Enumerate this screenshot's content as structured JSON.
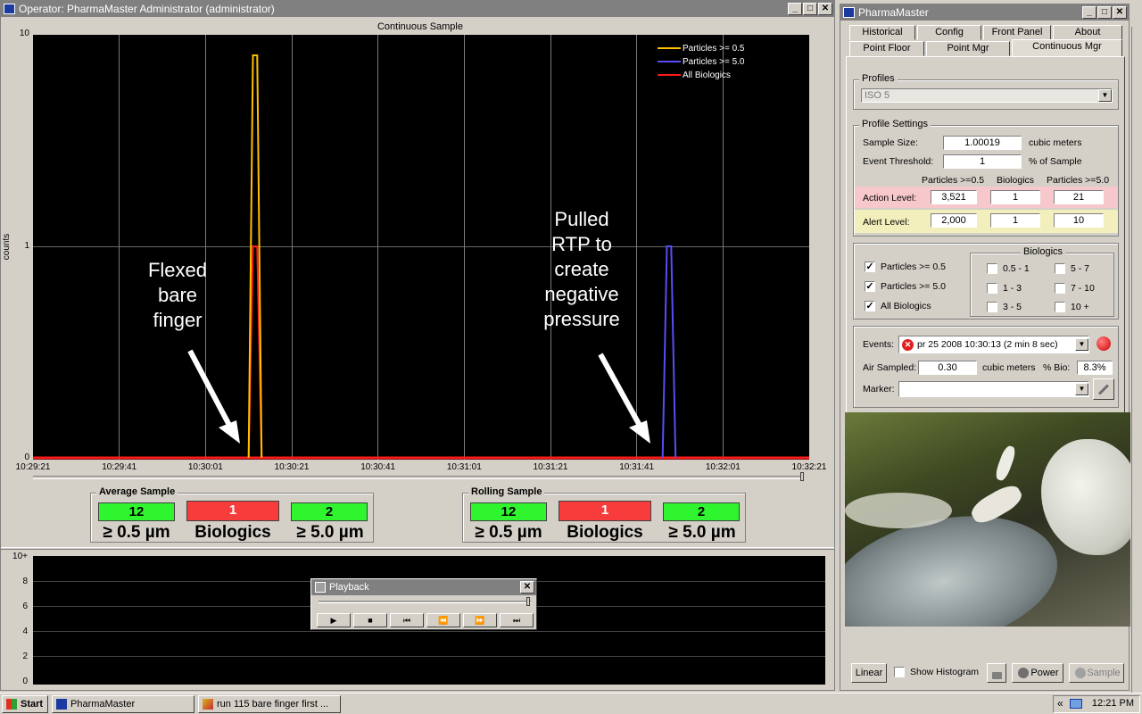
{
  "operator_window": {
    "title": "Operator: PharmaMaster Administrator (administrator)",
    "controls": [
      "_",
      "□",
      "✕"
    ]
  },
  "main_chart": {
    "title": "Continuous Sample",
    "ylabel": "counts",
    "yticks": [
      "10",
      "1",
      "0"
    ],
    "xticks": [
      "10:29:21",
      "10:29:41",
      "10:30:01",
      "10:30:21",
      "10:30:41",
      "10:31:01",
      "10:31:21",
      "10:31:41",
      "10:32:01",
      "10:32:21"
    ],
    "legend": [
      "Particles >= 0.5",
      "Particles >= 5.0",
      "All Biologics"
    ],
    "colors": {
      "p05": "#ffc000",
      "p50": "#5a4cf5",
      "bio": "#ff1a1a"
    },
    "annotation_left": [
      "Flexed",
      "bare",
      "finger"
    ],
    "annotation_right": [
      "Pulled",
      "RTP to",
      "create",
      "negative",
      "pressure"
    ]
  },
  "chart_data": {
    "type": "line",
    "title": "Continuous Sample",
    "xlabel": "",
    "ylabel": "counts",
    "yscale": "log",
    "ylim": [
      0,
      10
    ],
    "xlim": [
      "10:29:21",
      "10:32:21"
    ],
    "series": [
      {
        "name": "Particles >= 0.5",
        "x": [
          "10:30:11",
          "10:30:12",
          "10:30:13",
          "10:30:14"
        ],
        "values": [
          0,
          8,
          8,
          0
        ]
      },
      {
        "name": "Particles >= 5.0",
        "x": [
          "10:31:47",
          "10:31:48",
          "10:31:49",
          "10:31:50"
        ],
        "values": [
          0,
          1,
          1,
          0
        ]
      },
      {
        "name": "All Biologics",
        "x": [
          "10:30:11",
          "10:30:12",
          "10:30:13",
          "10:30:14"
        ],
        "values": [
          0,
          1,
          1,
          0
        ]
      }
    ]
  },
  "average_sample": {
    "title": "Average Sample",
    "p05": "12",
    "bio": "1",
    "p50": "2",
    "p05_label": "≥ 0.5 µm",
    "bio_label": "Biologics",
    "p50_label": "≥ 5.0 µm"
  },
  "rolling_sample": {
    "title": "Rolling Sample",
    "p05": "12",
    "bio": "1",
    "p50": "2",
    "p05_label": "≥ 0.5 µm",
    "bio_label": "Biologics",
    "p50_label": "≥ 5.0 µm"
  },
  "lower_chart": {
    "yticks": [
      "10+",
      "8",
      "6",
      "4",
      "2",
      "0"
    ]
  },
  "playback": {
    "title": "Playback",
    "close": "✕",
    "buttons": [
      "▶",
      "■",
      "⏮",
      "⏪",
      "⏩",
      "⏭"
    ]
  },
  "pm_window": {
    "title": "PharmaMaster",
    "controls": [
      "_",
      "□",
      "✕"
    ],
    "tabs_row1": [
      "Historical",
      "Config",
      "Front Panel",
      "About"
    ],
    "tabs_row2": [
      "Point Floor",
      "Point Mgr",
      "Continuous Mgr"
    ],
    "profiles_label": "Profiles",
    "profile_value": "ISO 5",
    "profile_settings_label": "Profile Settings",
    "sample_size_label": "Sample Size:",
    "sample_size_value": "1.00019",
    "sample_size_unit": "cubic meters",
    "event_threshold_label": "Event Threshold:",
    "event_threshold_value": "1",
    "event_threshold_unit": "% of Sample",
    "col_p05": "Particles >=0.5",
    "col_bio": "Biologics",
    "col_p50": "Particles >=5.0",
    "action_label": "Action Level:",
    "action_values": [
      "3,521",
      "1",
      "21"
    ],
    "alert_label": "Alert Level:",
    "alert_values": [
      "2,000",
      "1",
      "10"
    ],
    "chk_p05": "Particles >= 0.5",
    "chk_p50": "Particles >= 5.0",
    "chk_bio": "All Biologics",
    "biologics_label": "Biologics",
    "bio_ranges": [
      "0.5 - 1",
      "5 - 7",
      "1 - 3",
      "7 - 10",
      "3 - 5",
      "10 +"
    ],
    "events_label": "Events:",
    "events_value": "pr 25 2008  10:30:13  (2 min 8 sec)",
    "air_sampled_label": "Air Sampled:",
    "air_sampled_value": "0.30",
    "air_sampled_unit": "cubic meters",
    "pct_bio_label": "% Bio:",
    "pct_bio_value": "8.3%",
    "marker_label": "Marker:",
    "btn_linear": "Linear",
    "show_histogram": "Show Histogram",
    "btn_power": "Power",
    "btn_sample": "Sample"
  },
  "taskbar": {
    "start": "Start",
    "task1": "PharmaMaster",
    "task2": "run 115 bare finger first ...",
    "tray_arrow": "«",
    "clock": "12:21 PM"
  }
}
